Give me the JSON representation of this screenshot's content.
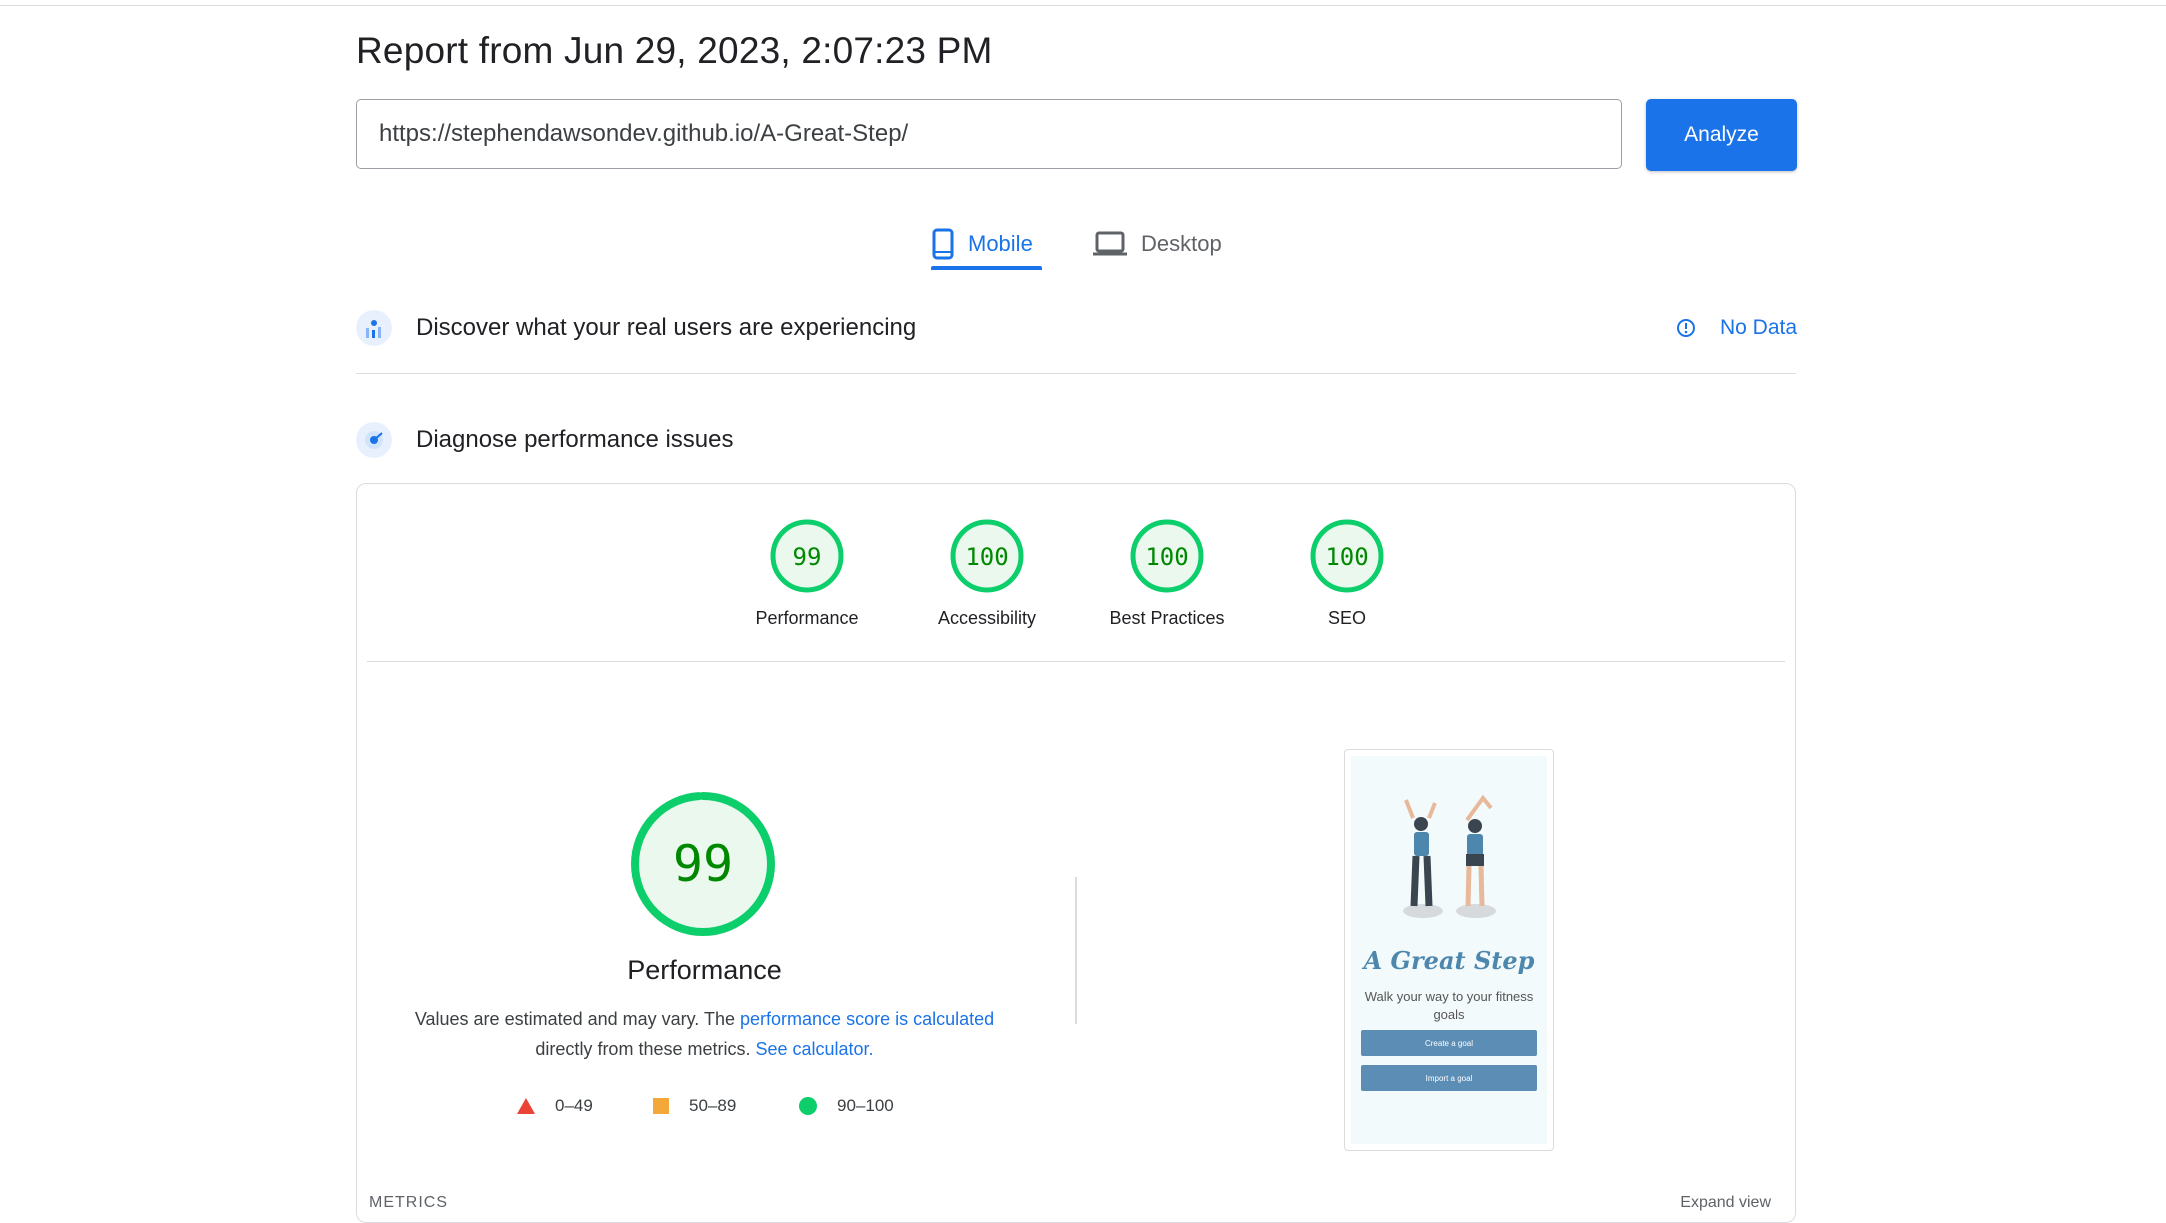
{
  "report": {
    "title": "Report from Jun 29, 2023, 2:07:23 PM"
  },
  "search": {
    "url": "https://stephendawsondev.github.io/A-Great-Step/",
    "analyze_label": "Analyze"
  },
  "tabs": [
    {
      "label": "Mobile",
      "icon": "phone-icon",
      "active": true
    },
    {
      "label": "Desktop",
      "icon": "laptop-icon",
      "active": false
    }
  ],
  "field_data": {
    "title": "Discover what your real users are experiencing",
    "status": "No Data"
  },
  "lab_data": {
    "title": "Diagnose performance issues",
    "scores": [
      {
        "label": "Performance",
        "score": "99"
      },
      {
        "label": "Accessibility",
        "score": "100"
      },
      {
        "label": "Best Practices",
        "score": "100"
      },
      {
        "label": "SEO",
        "score": "100"
      }
    ],
    "main_score": "99",
    "main_label": "Performance",
    "desc_prefix": "Values are estimated and may vary. The ",
    "desc_link1": "performance score is calculated",
    "desc_middle": " directly from these metrics. ",
    "desc_link2": "See calculator.",
    "legend": [
      {
        "range": "0–49",
        "shape": "triangle",
        "color": "#eb4335"
      },
      {
        "range": "50–89",
        "shape": "square",
        "color": "#f4a83a"
      },
      {
        "range": "90–100",
        "shape": "circle",
        "color": "#0cce6b"
      }
    ],
    "metrics_label": "METRICS",
    "expand_label": "Expand view"
  },
  "screenshot": {
    "title": "A Great Step",
    "subtitle": "Walk your way to your fitness goals",
    "button1": "Create a goal",
    "button2": "Import a goal"
  },
  "colors": {
    "accent": "#1a73e8",
    "pass": "#0cce6b",
    "pass_text": "#008800"
  }
}
